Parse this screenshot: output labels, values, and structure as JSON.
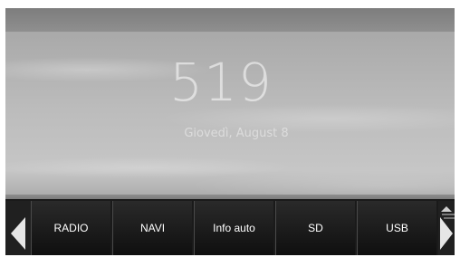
{
  "home": {
    "time": "519",
    "date": "Giovedì, August 8"
  },
  "dock": {
    "items": [
      {
        "label": "RADIO"
      },
      {
        "label": "NAVI"
      },
      {
        "label": "Info auto"
      },
      {
        "label": "SD"
      },
      {
        "label": "USB"
      }
    ],
    "prev_icon": "chevron-left-icon",
    "next_icon": "chevron-right-icon"
  }
}
